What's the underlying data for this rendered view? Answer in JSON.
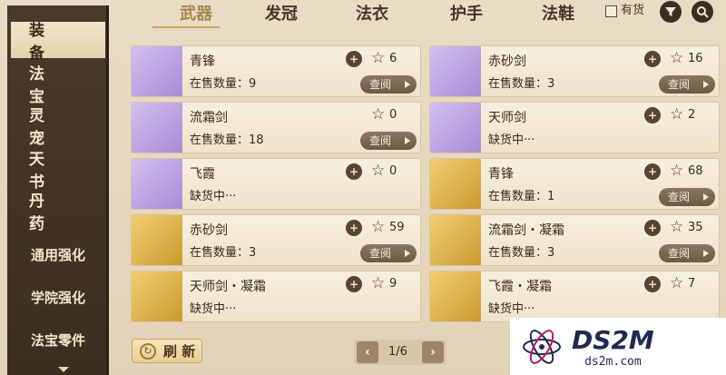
{
  "sidebar": {
    "items": [
      {
        "label": "装　　备",
        "active": true
      },
      {
        "label": "法　　宝"
      },
      {
        "label": "灵　　宠"
      },
      {
        "label": "天　　书"
      },
      {
        "label": "丹　　药"
      },
      {
        "label": "通用强化"
      },
      {
        "label": "学院强化"
      },
      {
        "label": "法宝零件"
      }
    ]
  },
  "tabs": [
    "武器",
    "发冠",
    "法衣",
    "护手",
    "法鞋"
  ],
  "filter": {
    "in_stock_label": "有货"
  },
  "view_label": "查阅",
  "cards": [
    {
      "name": "青锋",
      "status": "在售数量：9",
      "fav": "6",
      "thumb": "purple"
    },
    {
      "name": "赤砂剑",
      "status": "在售数量：3",
      "fav": "16",
      "thumb": "purple"
    },
    {
      "name": "流霜剑",
      "status": "在售数量：18",
      "fav": "0",
      "thumb": "purple"
    },
    {
      "name": "天师剑",
      "status": "缺货中···",
      "fav": "2",
      "thumb": "purple"
    },
    {
      "name": "飞霞",
      "status": "缺货中···",
      "fav": "0",
      "thumb": "purple"
    },
    {
      "name": "青锋",
      "status": "在售数量：1",
      "fav": "68",
      "thumb": "gold"
    },
    {
      "name": "赤砂剑",
      "status": "在售数量：3",
      "fav": "59",
      "thumb": "gold"
    },
    {
      "name": "流霜剑・凝霜",
      "status": "在售数量：3",
      "fav": "35",
      "thumb": "gold"
    },
    {
      "name": "天师剑・凝霜",
      "status": "缺货中···",
      "fav": "9",
      "thumb": "gold"
    },
    {
      "name": "飞霞・凝霜",
      "status": "缺货中···",
      "fav": "7",
      "thumb": "gold"
    }
  ],
  "refresh_label": "刷 新",
  "pager": {
    "text": "1/6"
  },
  "watermark": {
    "title": "DS2M",
    "url": "ds2m.com"
  }
}
